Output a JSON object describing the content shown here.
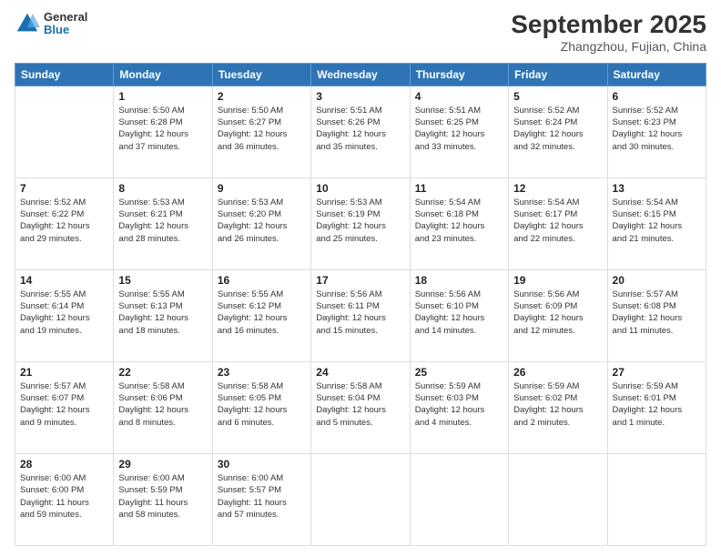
{
  "header": {
    "logo_line1": "General",
    "logo_line2": "Blue",
    "title": "September 2025",
    "subtitle": "Zhangzhou, Fujian, China"
  },
  "days_of_week": [
    "Sunday",
    "Monday",
    "Tuesday",
    "Wednesday",
    "Thursday",
    "Friday",
    "Saturday"
  ],
  "weeks": [
    [
      {
        "day": "",
        "info": ""
      },
      {
        "day": "1",
        "info": "Sunrise: 5:50 AM\nSunset: 6:28 PM\nDaylight: 12 hours\nand 37 minutes."
      },
      {
        "day": "2",
        "info": "Sunrise: 5:50 AM\nSunset: 6:27 PM\nDaylight: 12 hours\nand 36 minutes."
      },
      {
        "day": "3",
        "info": "Sunrise: 5:51 AM\nSunset: 6:26 PM\nDaylight: 12 hours\nand 35 minutes."
      },
      {
        "day": "4",
        "info": "Sunrise: 5:51 AM\nSunset: 6:25 PM\nDaylight: 12 hours\nand 33 minutes."
      },
      {
        "day": "5",
        "info": "Sunrise: 5:52 AM\nSunset: 6:24 PM\nDaylight: 12 hours\nand 32 minutes."
      },
      {
        "day": "6",
        "info": "Sunrise: 5:52 AM\nSunset: 6:23 PM\nDaylight: 12 hours\nand 30 minutes."
      }
    ],
    [
      {
        "day": "7",
        "info": "Sunrise: 5:52 AM\nSunset: 6:22 PM\nDaylight: 12 hours\nand 29 minutes."
      },
      {
        "day": "8",
        "info": "Sunrise: 5:53 AM\nSunset: 6:21 PM\nDaylight: 12 hours\nand 28 minutes."
      },
      {
        "day": "9",
        "info": "Sunrise: 5:53 AM\nSunset: 6:20 PM\nDaylight: 12 hours\nand 26 minutes."
      },
      {
        "day": "10",
        "info": "Sunrise: 5:53 AM\nSunset: 6:19 PM\nDaylight: 12 hours\nand 25 minutes."
      },
      {
        "day": "11",
        "info": "Sunrise: 5:54 AM\nSunset: 6:18 PM\nDaylight: 12 hours\nand 23 minutes."
      },
      {
        "day": "12",
        "info": "Sunrise: 5:54 AM\nSunset: 6:17 PM\nDaylight: 12 hours\nand 22 minutes."
      },
      {
        "day": "13",
        "info": "Sunrise: 5:54 AM\nSunset: 6:15 PM\nDaylight: 12 hours\nand 21 minutes."
      }
    ],
    [
      {
        "day": "14",
        "info": "Sunrise: 5:55 AM\nSunset: 6:14 PM\nDaylight: 12 hours\nand 19 minutes."
      },
      {
        "day": "15",
        "info": "Sunrise: 5:55 AM\nSunset: 6:13 PM\nDaylight: 12 hours\nand 18 minutes."
      },
      {
        "day": "16",
        "info": "Sunrise: 5:55 AM\nSunset: 6:12 PM\nDaylight: 12 hours\nand 16 minutes."
      },
      {
        "day": "17",
        "info": "Sunrise: 5:56 AM\nSunset: 6:11 PM\nDaylight: 12 hours\nand 15 minutes."
      },
      {
        "day": "18",
        "info": "Sunrise: 5:56 AM\nSunset: 6:10 PM\nDaylight: 12 hours\nand 14 minutes."
      },
      {
        "day": "19",
        "info": "Sunrise: 5:56 AM\nSunset: 6:09 PM\nDaylight: 12 hours\nand 12 minutes."
      },
      {
        "day": "20",
        "info": "Sunrise: 5:57 AM\nSunset: 6:08 PM\nDaylight: 12 hours\nand 11 minutes."
      }
    ],
    [
      {
        "day": "21",
        "info": "Sunrise: 5:57 AM\nSunset: 6:07 PM\nDaylight: 12 hours\nand 9 minutes."
      },
      {
        "day": "22",
        "info": "Sunrise: 5:58 AM\nSunset: 6:06 PM\nDaylight: 12 hours\nand 8 minutes."
      },
      {
        "day": "23",
        "info": "Sunrise: 5:58 AM\nSunset: 6:05 PM\nDaylight: 12 hours\nand 6 minutes."
      },
      {
        "day": "24",
        "info": "Sunrise: 5:58 AM\nSunset: 6:04 PM\nDaylight: 12 hours\nand 5 minutes."
      },
      {
        "day": "25",
        "info": "Sunrise: 5:59 AM\nSunset: 6:03 PM\nDaylight: 12 hours\nand 4 minutes."
      },
      {
        "day": "26",
        "info": "Sunrise: 5:59 AM\nSunset: 6:02 PM\nDaylight: 12 hours\nand 2 minutes."
      },
      {
        "day": "27",
        "info": "Sunrise: 5:59 AM\nSunset: 6:01 PM\nDaylight: 12 hours\nand 1 minute."
      }
    ],
    [
      {
        "day": "28",
        "info": "Sunrise: 6:00 AM\nSunset: 6:00 PM\nDaylight: 11 hours\nand 59 minutes."
      },
      {
        "day": "29",
        "info": "Sunrise: 6:00 AM\nSunset: 5:59 PM\nDaylight: 11 hours\nand 58 minutes."
      },
      {
        "day": "30",
        "info": "Sunrise: 6:00 AM\nSunset: 5:57 PM\nDaylight: 11 hours\nand 57 minutes."
      },
      {
        "day": "",
        "info": ""
      },
      {
        "day": "",
        "info": ""
      },
      {
        "day": "",
        "info": ""
      },
      {
        "day": "",
        "info": ""
      }
    ]
  ]
}
